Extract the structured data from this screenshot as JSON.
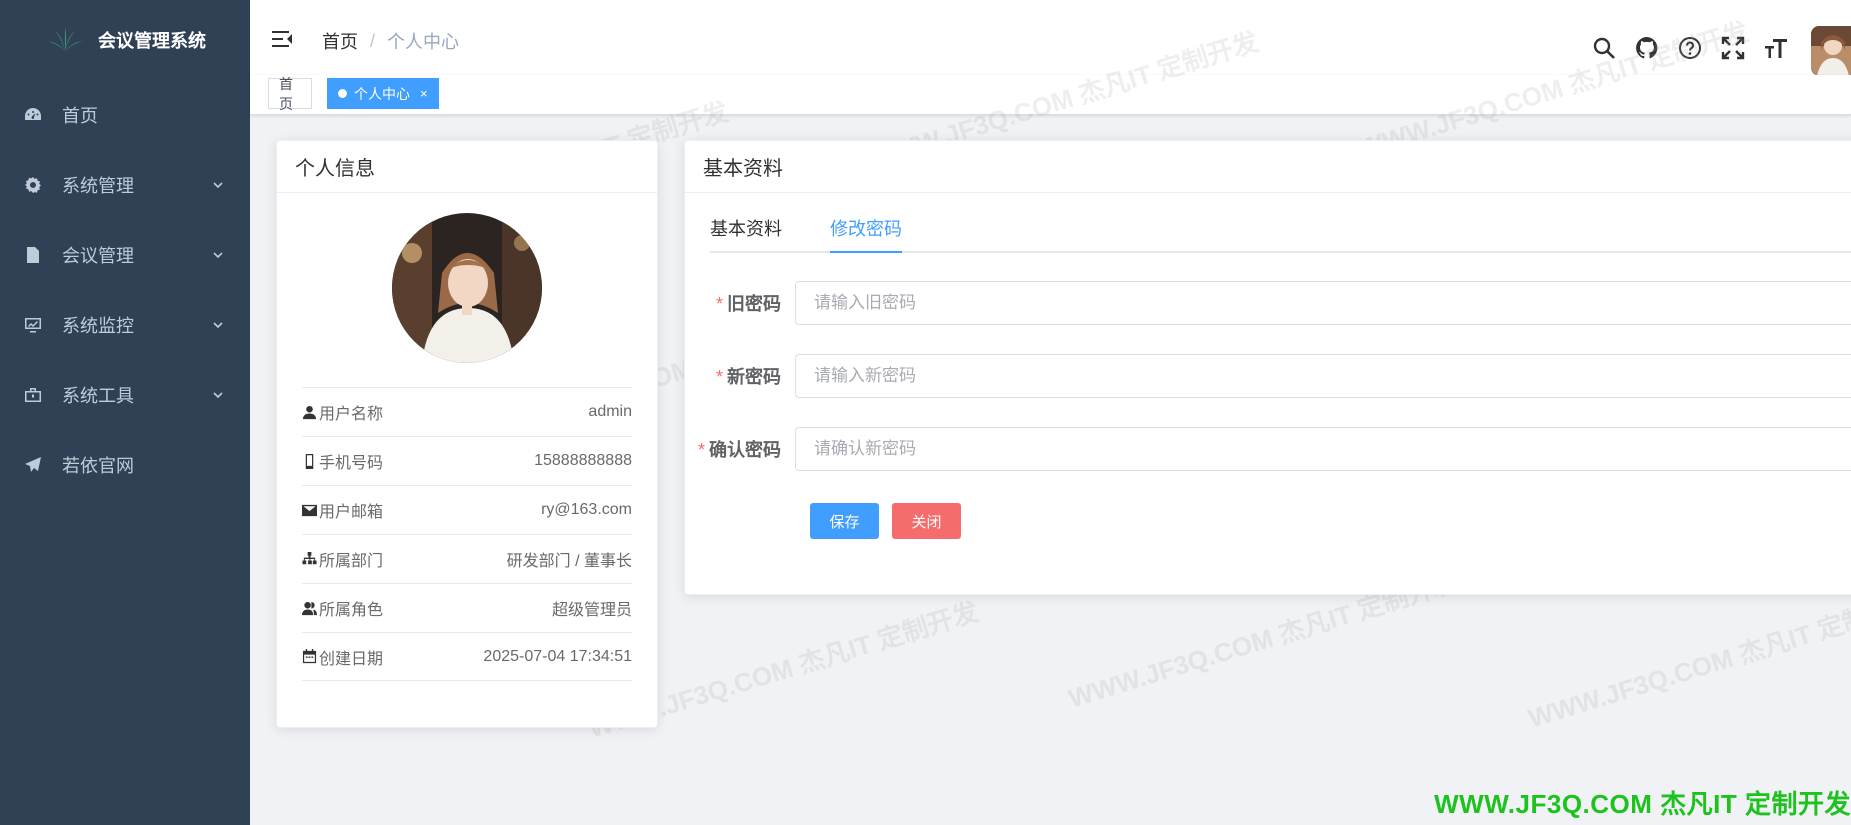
{
  "app": {
    "title": "会议管理系统"
  },
  "sidebar": {
    "items": [
      {
        "label": "首页",
        "icon": "dashboard-icon",
        "has_children": false
      },
      {
        "label": "系统管理",
        "icon": "gear-icon",
        "has_children": true
      },
      {
        "label": "会议管理",
        "icon": "document-icon",
        "has_children": true
      },
      {
        "label": "系统监控",
        "icon": "monitor-icon",
        "has_children": true
      },
      {
        "label": "系统工具",
        "icon": "toolbox-icon",
        "has_children": true
      },
      {
        "label": "若依官网",
        "icon": "paper-plane-icon",
        "has_children": false
      }
    ]
  },
  "navbar": {
    "breadcrumb": [
      "首页",
      "个人中心"
    ],
    "breadcrumb_separator": "/",
    "icons": [
      "search-icon",
      "github-icon",
      "help-icon",
      "fullscreen-icon",
      "font-size-icon"
    ]
  },
  "tags": [
    {
      "label": "首页",
      "active": false
    },
    {
      "label": "个人中心",
      "active": true,
      "closable": true,
      "close_glyph": "×"
    }
  ],
  "profile": {
    "title": "个人信息",
    "rows": [
      {
        "icon": "user-icon",
        "label": "用户名称",
        "value": "admin"
      },
      {
        "icon": "phone-icon",
        "label": "手机号码",
        "value": "15888888888"
      },
      {
        "icon": "email-icon",
        "label": "用户邮箱",
        "value": "ry@163.com"
      },
      {
        "icon": "tree-icon",
        "label": "所属部门",
        "value": "研发部门 / 董事长"
      },
      {
        "icon": "peoples-icon",
        "label": "所属角色",
        "value": "超级管理员"
      },
      {
        "icon": "date-icon",
        "label": "创建日期",
        "value": "2025-07-04 17:34:51"
      }
    ]
  },
  "form_card": {
    "title": "基本资料",
    "tabs": [
      {
        "label": "基本资料",
        "active": false
      },
      {
        "label": "修改密码",
        "active": true
      }
    ],
    "fields": [
      {
        "label": "旧密码",
        "placeholder": "请输入旧密码",
        "required": true,
        "required_mark": "*"
      },
      {
        "label": "新密码",
        "placeholder": "请输入新密码",
        "required": true,
        "required_mark": "*"
      },
      {
        "label": "确认密码",
        "placeholder": "请确认新密码",
        "required": true,
        "required_mark": "*"
      }
    ],
    "buttons": {
      "save": "保存",
      "close": "关闭"
    }
  },
  "watermark": {
    "text": "WWW.JF3Q.COM 杰凡IT 定制开发",
    "footer": "WWW.JF3Q.COM 杰凡IT  定制开发"
  },
  "colors": {
    "sidebar_bg": "#304156",
    "primary": "#409eff",
    "danger": "#f56c6c",
    "footer_watermark": "#1ec21e"
  }
}
